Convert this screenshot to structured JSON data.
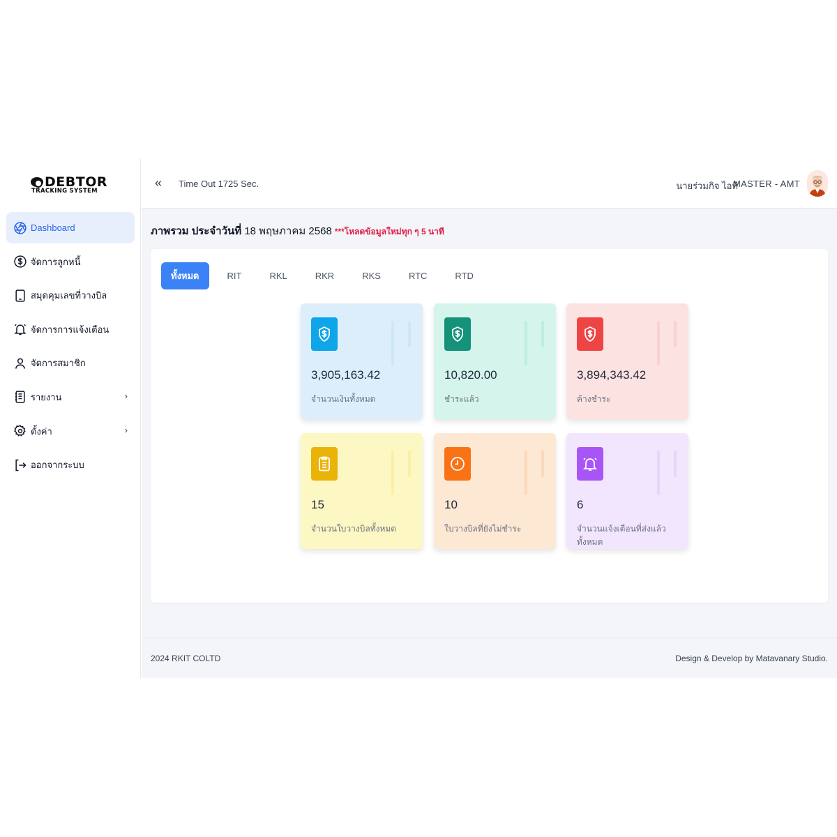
{
  "app": {
    "logo_text": "DEBTOR",
    "logo_sub": "TRACKING SYSTEM"
  },
  "sidebar": {
    "items": [
      {
        "label": "Dashboard",
        "icon": "aperture-icon",
        "active": true
      },
      {
        "label": "จัดการลูกหนี้",
        "icon": "dollar-circle-icon"
      },
      {
        "label": "สมุดคุมเลขที่วางบิล",
        "icon": "tablet-icon"
      },
      {
        "label": "จัดการการแจ้งเตือน",
        "icon": "bell-icon"
      },
      {
        "label": "จัดการสมาชิก",
        "icon": "user-icon"
      },
      {
        "label": "รายงาน",
        "icon": "report-icon",
        "chevron": "›"
      },
      {
        "label": "ตั้งค่า",
        "icon": "gear-icon",
        "chevron": "›"
      },
      {
        "label": "ออกจากระบบ",
        "icon": "logout-icon"
      }
    ]
  },
  "topbar": {
    "collapse_icon": "«",
    "timeout": "Time Out 1725 Sec.",
    "user_name": "นายร่วมกิจ ไอที",
    "user_role": "MASTER - AMT"
  },
  "page": {
    "title_prefix": "ภาพรวม ประจำวันที่ ",
    "title_date": "18 พฤษภาคม 2568",
    "note": "***โหลดข้อมูลใหม่ทุก ๆ 5 นาที"
  },
  "tabs": [
    {
      "label": "ทั้งหมด",
      "active": true
    },
    {
      "label": "RIT"
    },
    {
      "label": "RKL"
    },
    {
      "label": "RKR"
    },
    {
      "label": "RKS"
    },
    {
      "label": "RTC"
    },
    {
      "label": "RTD"
    }
  ],
  "cards": [
    {
      "value": "3,905,163.42",
      "label": "จำนวนเงินทั้งหมด",
      "icon": "dollar-shield-icon",
      "bg": "#dceefb",
      "icon_bg": "#0ea5e9",
      "accent": "#bfe0f6"
    },
    {
      "value": "10,820.00",
      "label": "ชำระแล้ว",
      "icon": "dollar-shield-icon",
      "bg": "#d5f4ec",
      "icon_bg": "#14937a",
      "accent": "#a6e7d6"
    },
    {
      "value": "3,894,343.42",
      "label": "ค้างชำระ",
      "icon": "dollar-shield-icon",
      "bg": "#fde2e2",
      "icon_bg": "#ef4444",
      "accent": "#f8c2c2"
    },
    {
      "value": "15",
      "label": "จำนวนใบวางบิลทั้งหมด",
      "icon": "clipboard-icon",
      "bg": "#fdf7c3",
      "icon_bg": "#eab308",
      "accent": "#f7e98a"
    },
    {
      "value": "10",
      "label": "ใบวางบิลที่ยังไม่ชำระ",
      "icon": "clock-icon",
      "bg": "#fde8d3",
      "icon_bg": "#f97316",
      "accent": "#f9c99c"
    },
    {
      "value": "6",
      "label": "จำนวนแจ้งเตือนที่ส่งแล้วทั้งหมด",
      "icon": "bell-icon",
      "bg": "#f1e6fd",
      "icon_bg": "#a855f7",
      "accent": "#dcc7f5"
    }
  ],
  "footer": {
    "left": "2024 RKIT COLTD",
    "right": "Design & Develop by Matavanary Studio."
  }
}
